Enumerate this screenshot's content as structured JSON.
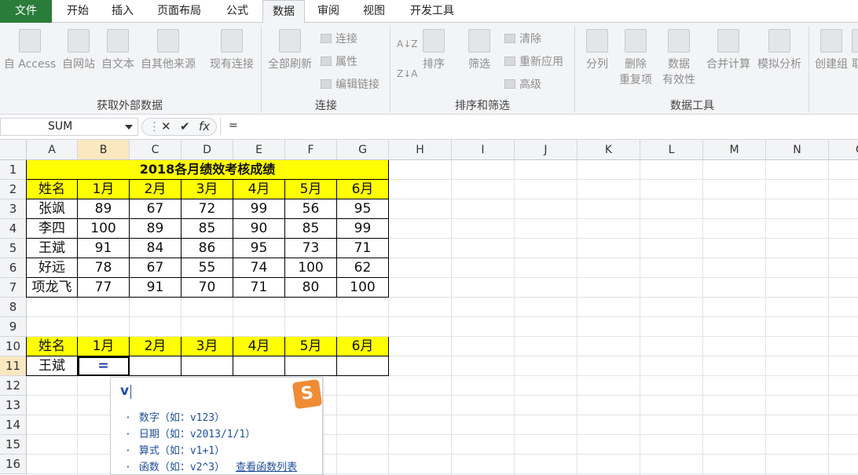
{
  "tabs": {
    "file": "文件",
    "home": "开始",
    "insert": "插入",
    "layout": "页面布局",
    "formulas": "公式",
    "data": "数据",
    "review": "审阅",
    "view": "视图",
    "developer": "开发工具"
  },
  "ribbon": {
    "get_external": {
      "access": "自 Access",
      "web": "自网站",
      "text": "自文本",
      "other": "自其他来源",
      "existing": "现有连接",
      "label": "获取外部数据"
    },
    "connections": {
      "refresh_all": "全部刷新",
      "connections": "连接",
      "properties": "属性",
      "edit_links": "编辑链接",
      "label": "连接"
    },
    "sort_filter": {
      "sort": "排序",
      "filter": "筛选",
      "clear": "清除",
      "reapply": "重新应用",
      "advanced": "高级",
      "label": "排序和筛选"
    },
    "data_tools": {
      "split": "分列",
      "remove_dup_1": "删除",
      "remove_dup_2": "重复项",
      "validation_1": "数据",
      "validation_2": "有效性",
      "consolidate": "合并计算",
      "whatif": "模拟分析",
      "label": "数据工具"
    },
    "outline": {
      "group": "创建组",
      "cut": "取"
    }
  },
  "formula_bar": {
    "name_box": "SUM",
    "cancel": "✕",
    "enter": "✔",
    "fx": "fx",
    "content": "="
  },
  "columns": [
    "A",
    "B",
    "C",
    "D",
    "E",
    "F",
    "G",
    "H",
    "I",
    "J",
    "K",
    "L",
    "M",
    "N",
    "O"
  ],
  "rows": [
    "1",
    "2",
    "3",
    "4",
    "5",
    "6",
    "7",
    "8",
    "9",
    "10",
    "11",
    "12",
    "13",
    "14",
    "15",
    "16"
  ],
  "table1": {
    "title": "2018各月绩效考核成绩",
    "header": [
      "姓名",
      "1月",
      "2月",
      "3月",
      "4月",
      "5月",
      "6月"
    ],
    "rows": [
      [
        "张飒",
        "89",
        "67",
        "72",
        "99",
        "56",
        "95"
      ],
      [
        "李四",
        "100",
        "89",
        "85",
        "90",
        "85",
        "99"
      ],
      [
        "王斌",
        "91",
        "84",
        "86",
        "95",
        "73",
        "71"
      ],
      [
        "好远",
        "78",
        "67",
        "55",
        "74",
        "100",
        "62"
      ],
      [
        "项龙飞",
        "77",
        "91",
        "70",
        "71",
        "80",
        "100"
      ]
    ]
  },
  "table2": {
    "header": [
      "姓名",
      "1月",
      "2月",
      "3月",
      "4月",
      "5月",
      "6月"
    ],
    "name": "王斌",
    "active_input": "="
  },
  "ime_popup": {
    "typed": "v",
    "logo": "S",
    "items": [
      "数字（如：v123）",
      "日期（如：v2013/1/1）",
      "算式（如：v1+1）",
      "函数（如：v2^3）"
    ],
    "link": "查看函数列表"
  }
}
